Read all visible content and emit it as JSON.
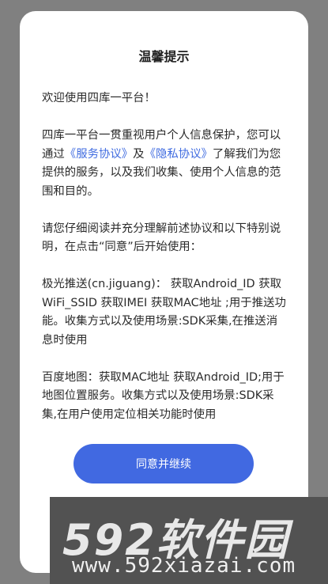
{
  "dialog": {
    "title": "温馨提示",
    "welcome": "欢迎使用四库一平台！",
    "privacy_prefix": "四库一平台一贯重视用户个人信息保护，您可以通过",
    "service_link": "《服务协议》",
    "privacy_and": "及",
    "privacy_link": "《隐私协议》",
    "privacy_suffix": "了解我们为您提供的服务，以及我们收集、使用个人信息的范围和目的。",
    "read_notice": "请您仔细阅读并充分理解前述协议和以下特别说明，在点击“同意”后开始使用：",
    "jpush_notice": " 极光推送(cn.jiguang)： 获取Android_ID 获取WiFi_SSID 获取IMEI 获取MAC地址 ;用于推送功能。收集方式以及使用场景:SDK采集,在推送消息时使用",
    "baidu_notice": " 百度地图：获取MAC地址 获取Android_ID;用于地图位置服务。收集方式以及使用场景:SDK采集,在用户使用定位相关功能时使用",
    "agree_button": "同意并继续"
  },
  "watermark": {
    "logo": "592软件园",
    "url": "www.592xiazai.com"
  },
  "colors": {
    "accent": "#4169e1",
    "link": "#3f6be0",
    "overlay": "#808080"
  }
}
